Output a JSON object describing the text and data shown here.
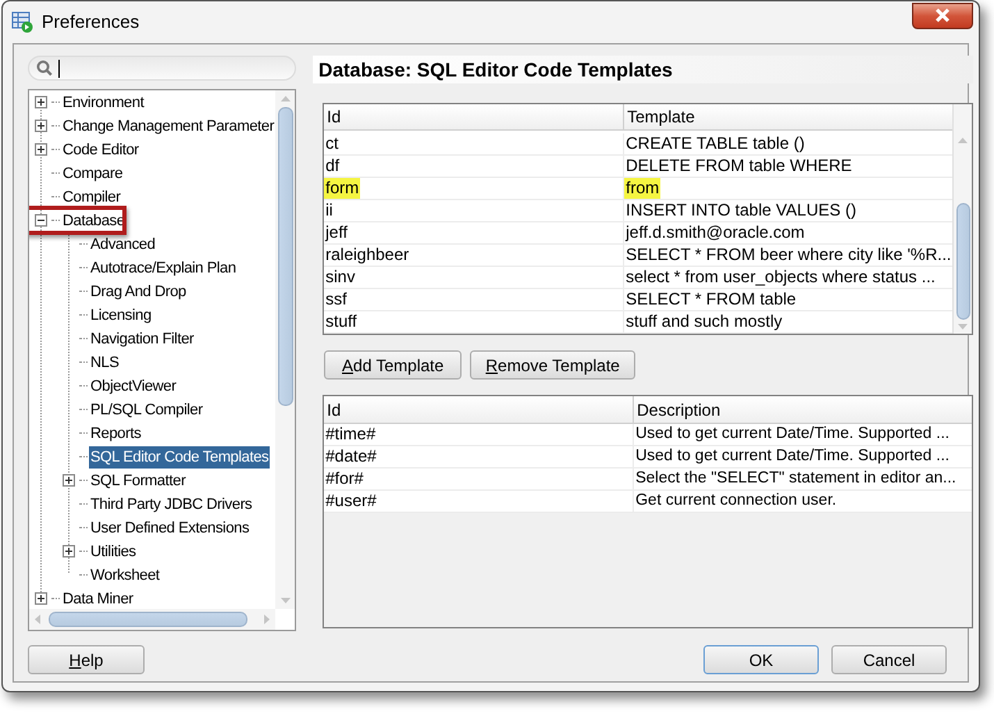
{
  "window": {
    "title": "Preferences"
  },
  "tree": [
    {
      "label": "Environment",
      "expanded": false,
      "selected": false
    },
    {
      "label": "Change Management Parameter",
      "expanded": false,
      "selected": false
    },
    {
      "label": "Code Editor",
      "expanded": false,
      "selected": false
    },
    {
      "label": "Compare",
      "selected": false
    },
    {
      "label": "Compiler",
      "selected": false
    },
    {
      "label": "Database",
      "expanded": true,
      "selected": false,
      "annotated": true,
      "children": [
        {
          "label": "Advanced",
          "selected": false
        },
        {
          "label": "Autotrace/Explain Plan",
          "selected": false
        },
        {
          "label": "Drag And Drop",
          "selected": false
        },
        {
          "label": "Licensing",
          "selected": false
        },
        {
          "label": "Navigation Filter",
          "selected": false
        },
        {
          "label": "NLS",
          "selected": false
        },
        {
          "label": "ObjectViewer",
          "selected": false
        },
        {
          "label": "PL/SQL Compiler",
          "selected": false
        },
        {
          "label": "Reports",
          "selected": false
        },
        {
          "label": "SQL Editor Code Templates",
          "selected": true
        },
        {
          "label": "SQL Formatter",
          "expanded": false,
          "selected": false
        },
        {
          "label": "Third Party JDBC Drivers",
          "selected": false
        },
        {
          "label": "User Defined Extensions",
          "selected": false
        },
        {
          "label": "Utilities",
          "expanded": false,
          "selected": false
        },
        {
          "label": "Worksheet",
          "selected": false
        }
      ]
    },
    {
      "label": "Data Miner",
      "expanded": false,
      "selected": false
    }
  ],
  "page_title": "Database: SQL Editor Code Templates",
  "templates": {
    "columns": [
      "Id",
      "Template"
    ],
    "rows": [
      {
        "id": "ct",
        "template": "CREATE TABLE table ()",
        "highlighted": false
      },
      {
        "id": "df",
        "template": "DELETE FROM table WHERE",
        "highlighted": false
      },
      {
        "id": "form",
        "template": "from",
        "highlighted": true
      },
      {
        "id": "ii",
        "template": "INSERT INTO table VALUES ()",
        "highlighted": false
      },
      {
        "id": "jeff",
        "template": "jeff.d.smith@oracle.com",
        "highlighted": false
      },
      {
        "id": "raleighbeer",
        "template": "SELECT * FROM beer where city like '%R...",
        "highlighted": false
      },
      {
        "id": "sinv",
        "template": "select * from user_objects where status ...",
        "highlighted": false
      },
      {
        "id": "ssf",
        "template": "SELECT * FROM table",
        "highlighted": false
      },
      {
        "id": "stuff",
        "template": "stuff and such mostly",
        "highlighted": false
      }
    ]
  },
  "template_buttons": [
    {
      "label": "Add Template"
    },
    {
      "label": "Remove Template"
    }
  ],
  "variables": {
    "columns": [
      "Id",
      "Description"
    ],
    "rows": [
      {
        "id": "#time#",
        "description": "Used to get current Date/Time. Supported ..."
      },
      {
        "id": "#date#",
        "description": "Used to get current Date/Time. Supported ..."
      },
      {
        "id": "#for#",
        "description": "Select the \"SELECT\" statement in editor an..."
      },
      {
        "id": "#user#",
        "description": "Get current connection user."
      }
    ]
  },
  "help_button": {
    "label": "Help"
  },
  "dialog_buttons": [
    {
      "label": "OK",
      "default": true
    },
    {
      "label": "Cancel",
      "default": false
    }
  ]
}
